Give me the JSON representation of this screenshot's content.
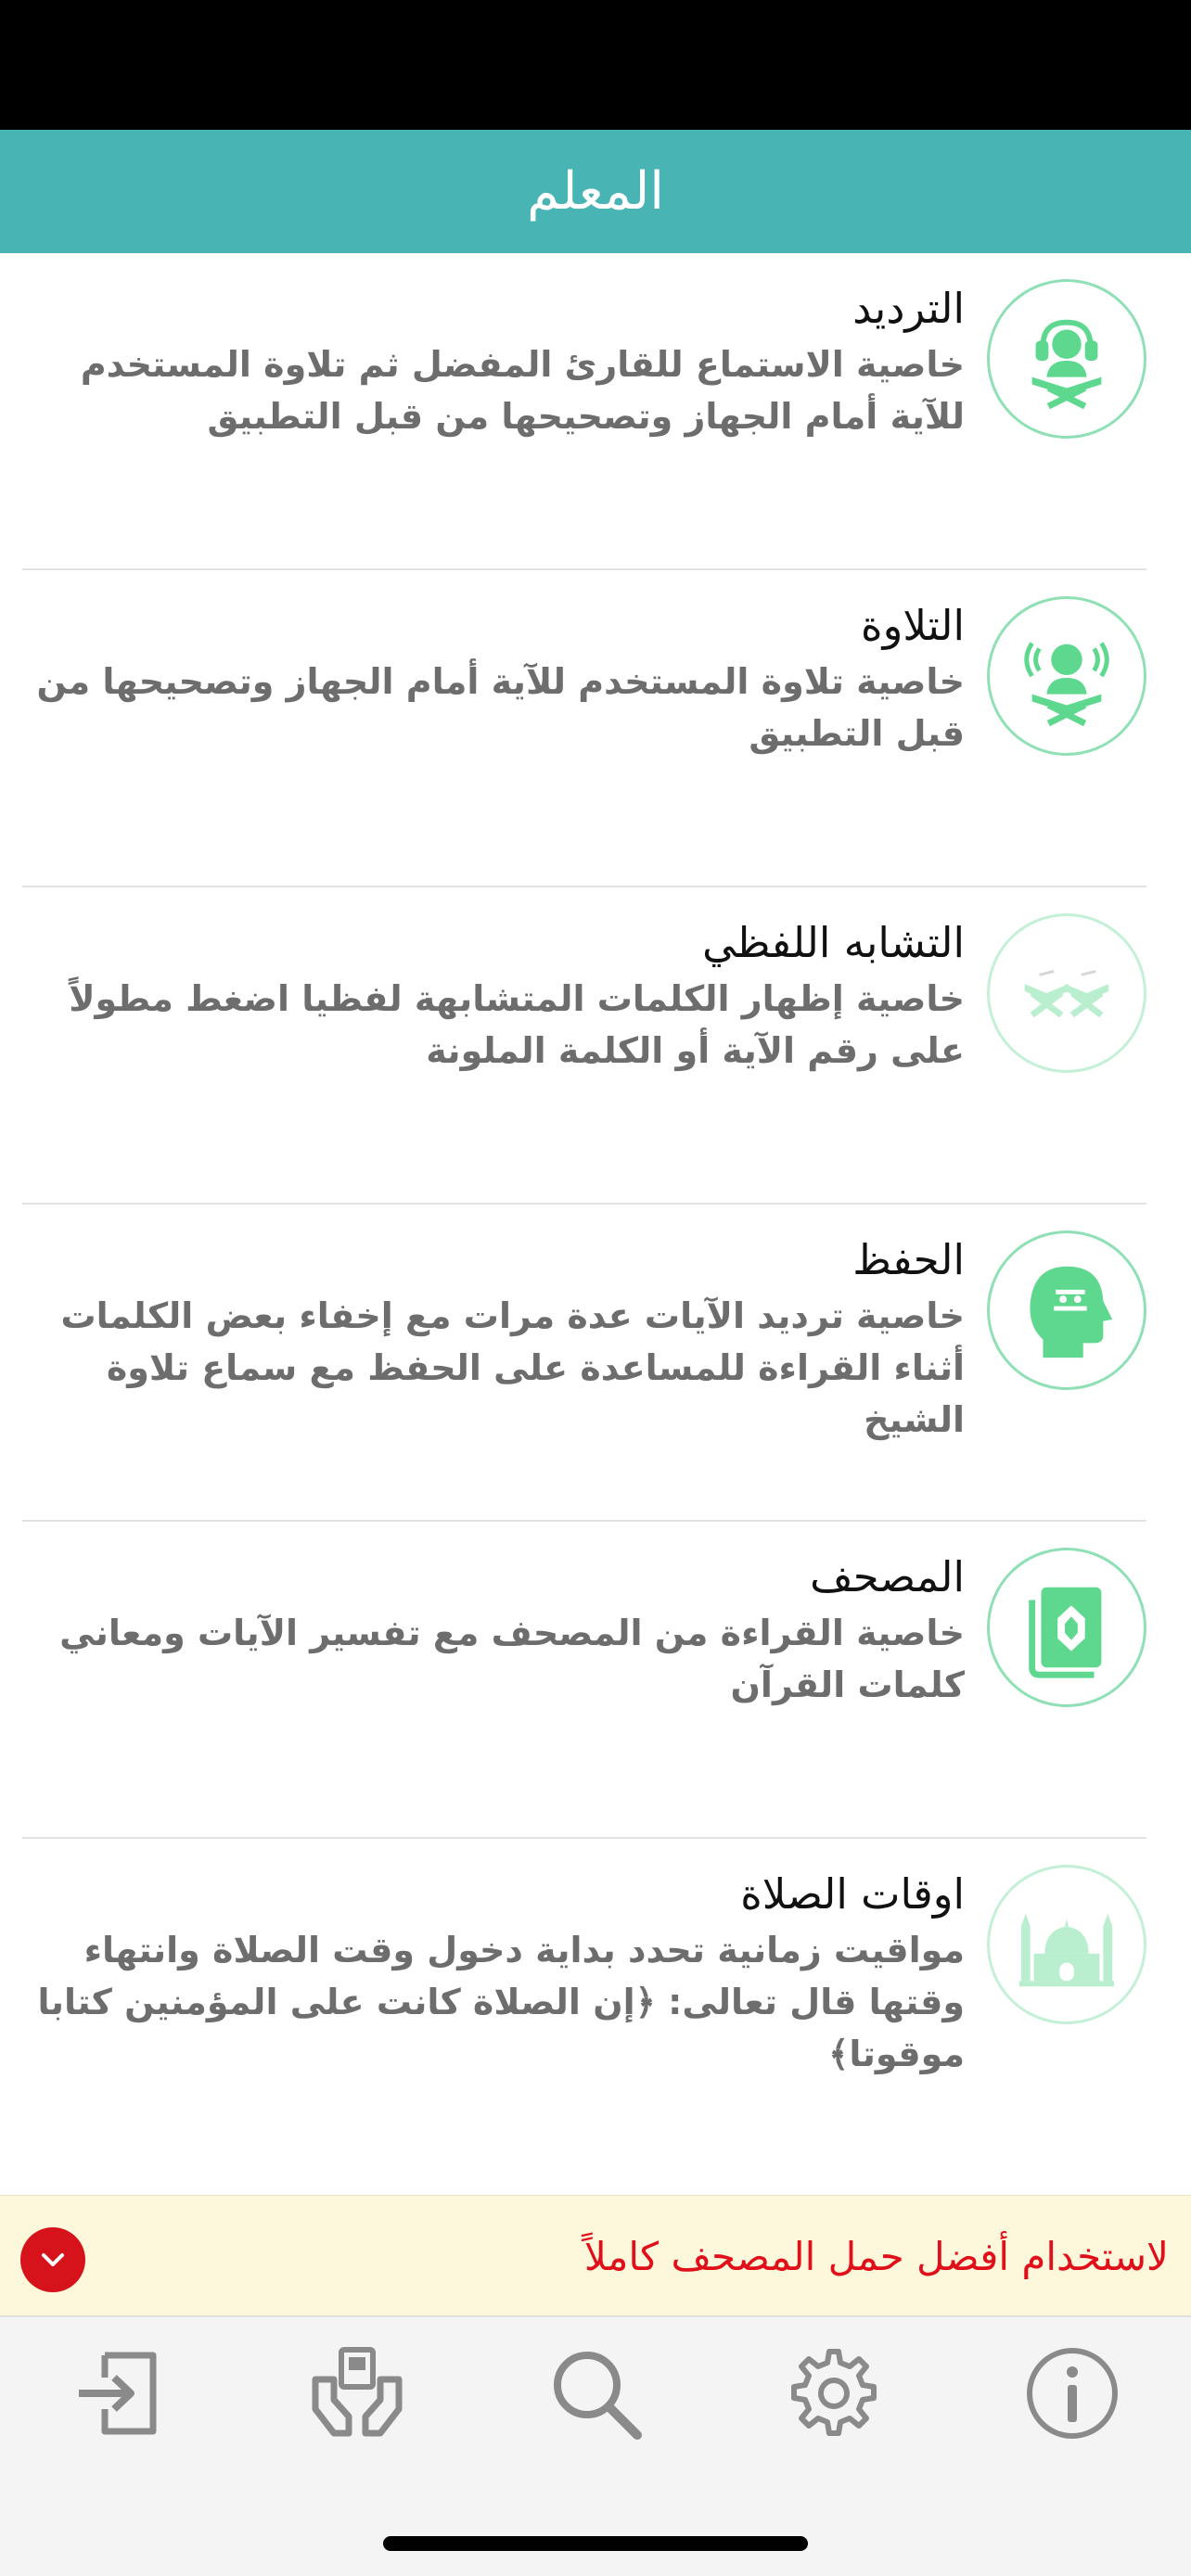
{
  "header": {
    "title": "المعلم"
  },
  "features": [
    {
      "title": "الترديد",
      "description": "خاصية الاستماع للقارئ المفضل ثم تلاوة المستخدم للآية أمام الجهاز وتصحيحها من قبل التطبيق",
      "icon": "quran-reader-headphones-icon"
    },
    {
      "title": "التلاوة",
      "description": "خاصية تلاوة المستخدم للآية أمام الجهاز وتصحيحها من قبل التطبيق",
      "icon": "quran-reader-mic-icon"
    },
    {
      "title": "التشابه اللفظي",
      "description": "خاصية إظهار الكلمات المتشابهة لفظيا اضغط مطولاً على رقم الآية أو الكلمة الملونة",
      "icon": "two-quran-stands-icon"
    },
    {
      "title": "الحفظ",
      "description": "خاصية ترديد الآيات عدة مرات مع إخفاء بعض الكلمات أثناء القراءة للمساعدة على الحفظ مع سماع تلاوة الشيخ",
      "icon": "head-quran-icon"
    },
    {
      "title": "المصحف",
      "description": "خاصية القراءة من المصحف مع تفسير الآيات ومعاني كلمات القرآن",
      "icon": "mushaf-book-icon"
    },
    {
      "title": "اوقات الصلاة",
      "description": "مواقيت زمانية تحدد بداية دخول وقت الصلاة وانتهاء وقتها قال تعالى: ﴿إن الصلاة كانت على المؤمنين كتابا موقوتا﴾",
      "icon": "mosque-icon"
    }
  ],
  "promo": {
    "text": "لاستخدام أفضل حمل المصحف كاملاً",
    "toggle_icon": "chevron-down-icon"
  },
  "tabs": [
    {
      "name": "login",
      "icon": "sign-in-icon"
    },
    {
      "name": "donate",
      "icon": "donate-hands-icon"
    },
    {
      "name": "search",
      "icon": "search-icon"
    },
    {
      "name": "settings",
      "icon": "gear-icon"
    },
    {
      "name": "info",
      "icon": "info-icon"
    }
  ],
  "colors": {
    "header_bg": "#48b5b4",
    "icon_green": "#5ed88f",
    "icon_border": "#8fe0b5",
    "promo_bg": "#fdf8dc",
    "promo_text": "#e0101a",
    "tab_icon": "#8a8a8a"
  }
}
